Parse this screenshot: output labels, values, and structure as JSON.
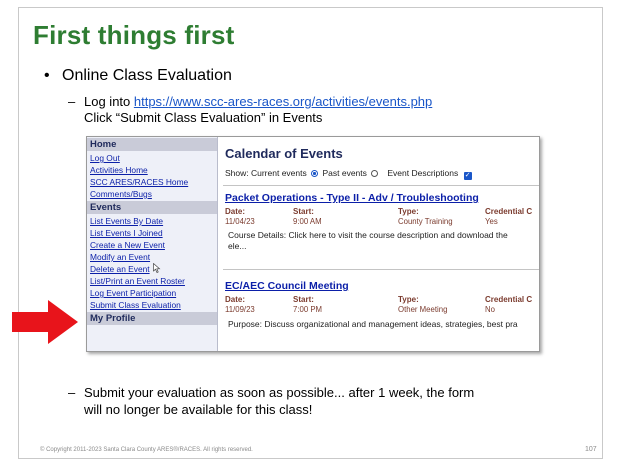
{
  "slide": {
    "title": "First things first",
    "bullet": "Online Class Evaluation",
    "step1_prefix": "Log into ",
    "step1_link": "https://www.scc-ares-races.org/activities/events.php",
    "step1_line2": "Click “Submit Class Evaluation” in Events",
    "step2_line1": "Submit your evaluation as soon as possible... after 1 week, the form",
    "step2_line2": "will no longer be available for this class!",
    "footer": "© Copyright 2011-2023 Santa Clara County ARES®/RACES. All rights reserved.",
    "page_number": "107"
  },
  "screenshot": {
    "nav": {
      "home_header": "Home",
      "home_links": [
        "Log Out",
        "Activities Home",
        "SCC ARES/RACES Home",
        "Comments/Bugs"
      ],
      "events_header": "Events",
      "events_links": [
        "List Events By Date",
        "List Events I Joined",
        "Create a New Event",
        "Modify an Event",
        "Delete an Event",
        "List/Print an Event Roster",
        "Log Event Participation",
        "Submit Class Evaluation"
      ],
      "profile_header": "My Profile"
    },
    "calendar_title": "Calendar of Events",
    "show_label": "Show: Current events",
    "past_label": "Past events",
    "descriptions_label": "Event Descriptions",
    "events": [
      {
        "title": "Packet Operations - Type II - Adv / Troubleshooting",
        "col_date": "Date:",
        "col_start": "Start:",
        "col_type": "Type:",
        "col_cred": "Credential C",
        "date": "11/04/23",
        "start": "9:00 AM",
        "type": "County Training",
        "cred": "Yes",
        "detail_line1": "Course Details: Click here to visit the course description and download the",
        "detail_line2": "ele..."
      },
      {
        "title": "EC/AEC Council Meeting",
        "col_date": "Date:",
        "col_start": "Start:",
        "col_type": "Type:",
        "col_cred": "Credential C",
        "date": "11/09/23",
        "start": "7:00 PM",
        "type": "Other Meeting",
        "cred": "No",
        "detail_line1": "Purpose: Discuss organizational and management ideas, strategies, best pra"
      }
    ]
  },
  "icons": [
    "red-arrow-icon",
    "mouse-cursor-icon",
    "checkbox-icon",
    "radio-icon"
  ],
  "colors": {
    "title_green": "#2e7d32",
    "arrow_red": "#e8141b",
    "link_blue": "#1a56c8",
    "nav_header_bg": "#c9cbd8"
  }
}
